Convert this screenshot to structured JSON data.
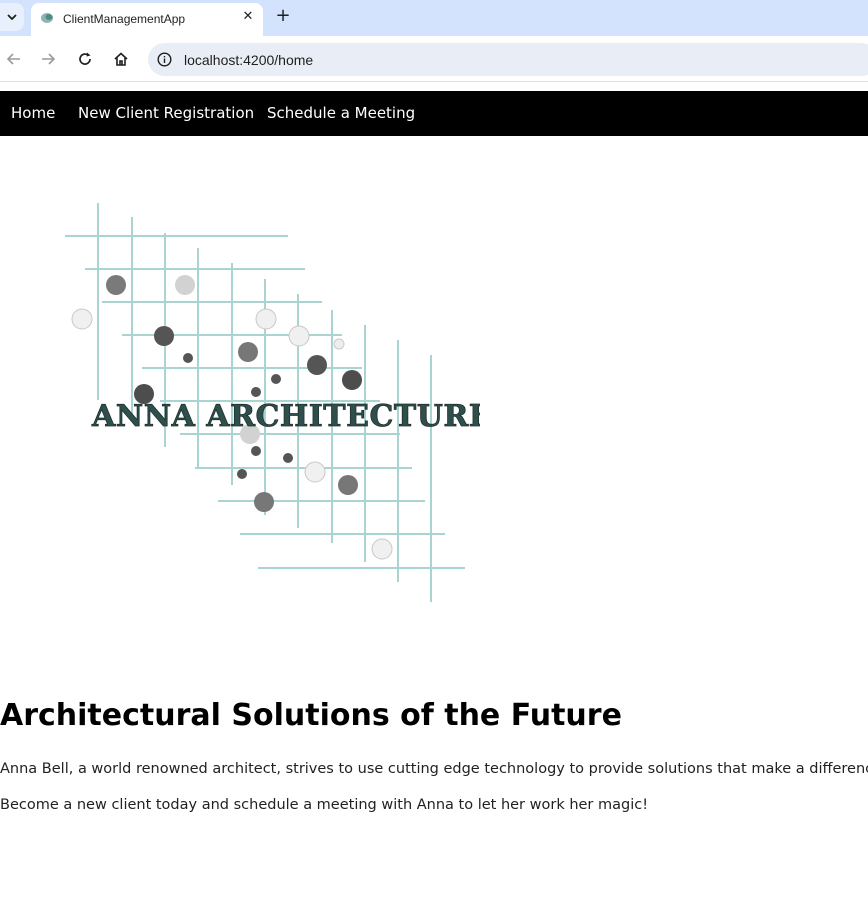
{
  "browser": {
    "tab_title": "ClientManagementApp",
    "url": "localhost:4200/home"
  },
  "nav": {
    "items": [
      {
        "label": "Home"
      },
      {
        "label": "New Client Registration"
      },
      {
        "label": "Schedule a Meeting"
      }
    ]
  },
  "logo": {
    "text": "ANNA ARCHITECTURE"
  },
  "content": {
    "headline": "Architectural Solutions of the Future",
    "paragraph1": "Anna Bell, a world renowned architect, strives to use cutting edge technology to provide solutions that make a difference.",
    "paragraph2": "Become a new client today and schedule a meeting with Anna to let her work her magic!"
  },
  "colors": {
    "tabstrip": "#d3e3fd",
    "navbar": "#000000",
    "grid_line": "#a8d5d1",
    "dot_dark": "#4a4a4a"
  }
}
